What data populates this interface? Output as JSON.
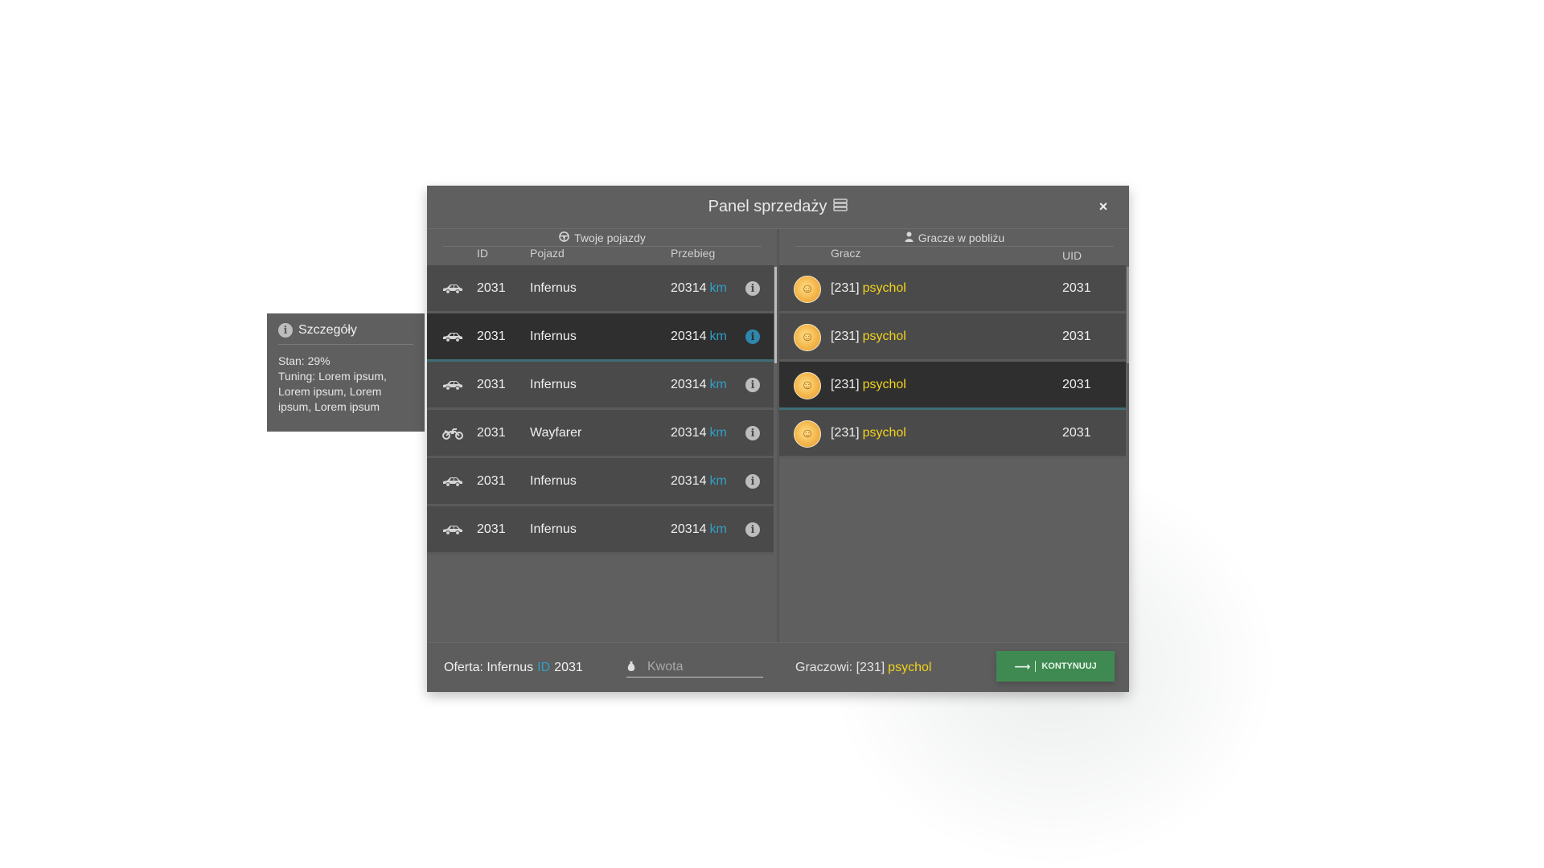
{
  "panel": {
    "title": "Panel sprzedaży",
    "title_icon": "money-stack-icon",
    "close": "×"
  },
  "vehicles": {
    "section_title": "Twoje pojazdy",
    "section_icon": "steering-wheel-icon",
    "columns": {
      "id": "ID",
      "vehicle": "Pojazd",
      "mileage": "Przebieg"
    },
    "unit": "km",
    "rows": [
      {
        "icon": "car-icon",
        "id": "2031",
        "name": "Infernus",
        "mileage": "20314",
        "selected": false
      },
      {
        "icon": "car-icon",
        "id": "2031",
        "name": "Infernus",
        "mileage": "20314",
        "selected": true
      },
      {
        "icon": "car-icon",
        "id": "2031",
        "name": "Infernus",
        "mileage": "20314",
        "selected": false
      },
      {
        "icon": "motorcycle-icon",
        "id": "2031",
        "name": "Wayfarer",
        "mileage": "20314",
        "selected": false
      },
      {
        "icon": "car-icon",
        "id": "2031",
        "name": "Infernus",
        "mileage": "20314",
        "selected": false
      },
      {
        "icon": "car-icon",
        "id": "2031",
        "name": "Infernus",
        "mileage": "20314",
        "selected": false
      }
    ]
  },
  "players": {
    "section_title": "Gracze w pobliżu",
    "section_icon": "user-icon",
    "columns": {
      "player": "Gracz",
      "uid": "UID"
    },
    "rows": [
      {
        "tag": "[231]",
        "name": "psychol",
        "uid": "2031",
        "selected": false
      },
      {
        "tag": "[231]",
        "name": "psychol",
        "uid": "2031",
        "selected": false
      },
      {
        "tag": "[231]",
        "name": "psychol",
        "uid": "2031",
        "selected": true
      },
      {
        "tag": "[231]",
        "name": "psychol",
        "uid": "2031",
        "selected": false
      }
    ]
  },
  "footer": {
    "offer_label": "Oferta:",
    "offer_vehicle": "Infernus",
    "offer_id_label": "ID",
    "offer_id": "2031",
    "amount_placeholder": "Kwota",
    "amount_value": "",
    "to_player_label": "Graczowi:",
    "to_player_tag": "[231]",
    "to_player_name": "psychol",
    "continue_label": "KONTYNUUJ"
  },
  "tooltip": {
    "title": "Szczegóły",
    "state_label": "Stan:",
    "state_value": "29%",
    "tuning_label": "Tuning:",
    "tuning_value": "Lorem ipsum, Lorem ipsum, Lorem ipsum, Lorem ipsum"
  },
  "colors": {
    "accent_blue": "#2fa0c7",
    "player_yellow": "#f2d31b",
    "continue_green": "#3f8a52",
    "panel_bg": "#5f5f5f"
  }
}
